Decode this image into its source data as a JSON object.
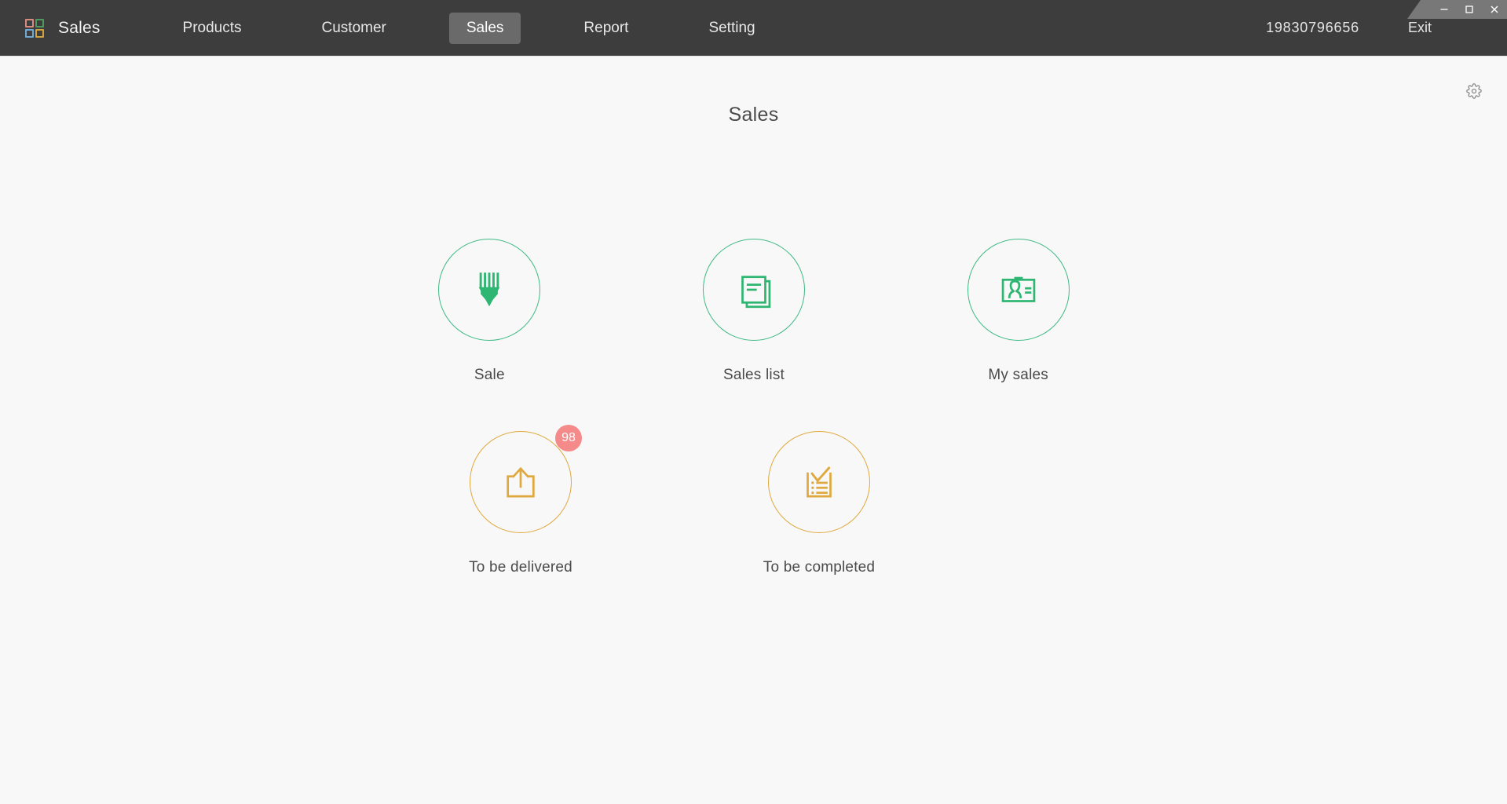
{
  "window": {
    "controls": [
      {
        "name": "minimize",
        "glyph": "minimize-icon"
      },
      {
        "name": "maximize",
        "glyph": "maximize-icon"
      },
      {
        "name": "close",
        "glyph": "close-icon"
      }
    ]
  },
  "topbar": {
    "logo_icon": "grid-logo-icon",
    "brand": "Sales",
    "nav": [
      {
        "label": "Products",
        "active": false
      },
      {
        "label": "Customer",
        "active": false
      },
      {
        "label": "Sales",
        "active": true
      },
      {
        "label": "Report",
        "active": false
      },
      {
        "label": "Setting",
        "active": false
      }
    ],
    "account": "19830796656",
    "exit_label": "Exit",
    "bg_color": "#3d3d3d",
    "active_tab_bg": "#6a6a6a"
  },
  "content": {
    "page_title": "Sales",
    "settings_icon": "gear-icon",
    "bg_color": "#f7f8f7"
  },
  "tiles": {
    "green_color": "#3fba85",
    "amber_color": "#e0a93f",
    "badge_color": "#f48a8a",
    "row1": [
      {
        "label": "Sale",
        "icon": "pen-nib-icon",
        "accent": "green",
        "badge": null
      },
      {
        "label": "Sales list",
        "icon": "documents-stack-icon",
        "accent": "green",
        "badge": null
      },
      {
        "label": "My sales",
        "icon": "id-card-icon",
        "accent": "green",
        "badge": null
      }
    ],
    "row2": [
      {
        "label": "To be delivered",
        "icon": "upload-box-icon",
        "accent": "amber",
        "badge": "98"
      },
      {
        "label": "To be completed",
        "icon": "checklist-icon",
        "accent": "amber",
        "badge": null
      }
    ]
  }
}
